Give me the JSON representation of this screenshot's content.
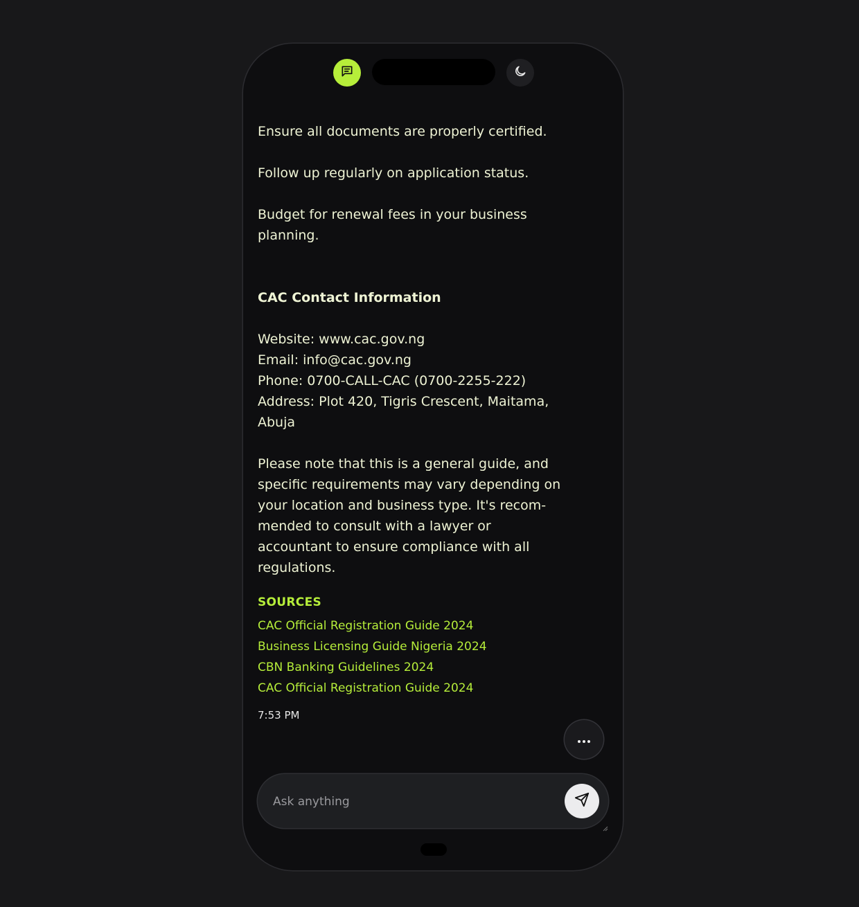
{
  "header": {
    "chat_icon": "chat-bubble-icon",
    "theme_icon": "moon-icon"
  },
  "message": {
    "tips": [
      "Ensure all documents are properly certified.",
      "Follow up regularly on application status.",
      "Budget for renewal fees in your business planning."
    ],
    "contact_heading": "CAC Contact Information",
    "contact": {
      "website": "Website: www.cac.gov.ng",
      "email": "Email: info@cac.gov.ng",
      "phone": "Phone: 0700-CALL-CAC (0700-2255-222)",
      "address": "Address: Plot 420, Tigris Crescent, Maitama, Abuja"
    },
    "disclaimer": "Please note that this is a general guide, and specific requirements may vary depending on your location and business type. It's recom-mended to consult with a lawyer or accountant to ensure compliance with all regulations.",
    "sources_title": "SOURCES",
    "sources": [
      "CAC Official Registration Guide 2024",
      "Business Licensing Guide Nigeria 2024",
      "CBN Banking Guidelines 2024",
      "CAC Official Registration Guide 2024"
    ],
    "timestamp": "7:53 PM"
  },
  "composer": {
    "placeholder": "Ask anything",
    "value": "",
    "send_icon": "send-icon",
    "more_icon": "more-horizontal-icon"
  },
  "colors": {
    "accent": "#b6ee3a",
    "background": "#18181a",
    "phone": "#0e0e10",
    "text": "#eef3d4"
  }
}
